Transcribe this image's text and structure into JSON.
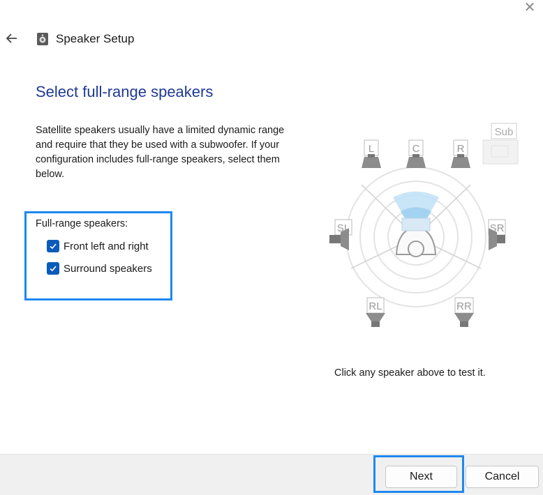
{
  "window": {
    "title": "Speaker Setup",
    "close_glyph": "✕"
  },
  "page": {
    "heading": "Select full-range speakers",
    "description": "Satellite speakers usually have a limited dynamic range and require that they be used with a subwoofer. If your configuration includes full-range speakers, select them below."
  },
  "full_range": {
    "label": "Full-range speakers:",
    "options": [
      {
        "label": "Front left and right",
        "checked": true
      },
      {
        "label": "Surround speakers",
        "checked": true
      }
    ]
  },
  "diagram": {
    "speakers": {
      "left": "L",
      "center": "C",
      "right": "R",
      "sub": "Sub",
      "side_left": "SL",
      "side_right": "SR",
      "rear_left": "RL",
      "rear_right": "RR"
    },
    "hint": "Click any speaker above to test it."
  },
  "footer": {
    "next_label": "Next",
    "cancel_label": "Cancel"
  },
  "colors": {
    "heading": "#1f3a93",
    "highlight": "#1e88f0",
    "checkbox": "#0b5cba"
  }
}
